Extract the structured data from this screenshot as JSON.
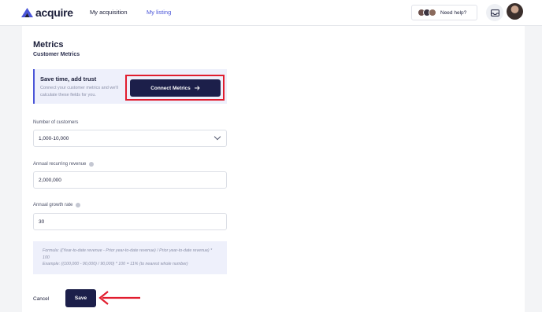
{
  "header": {
    "brand": "acquire",
    "nav": [
      {
        "label": "My acquisition",
        "active": false
      },
      {
        "label": "My listing",
        "active": true
      }
    ],
    "help_label": "Need help?"
  },
  "page": {
    "title": "Metrics",
    "subtitle": "Customer Metrics"
  },
  "promo": {
    "title": "Save time, add trust",
    "description": "Connect your customer metrics and we'll calculate these fields for you.",
    "button_label": "Connect Metrics"
  },
  "fields": {
    "customers": {
      "label": "Number of customers",
      "value": "1,000-10,000"
    },
    "arr": {
      "label": "Annual recurring revenue",
      "value": "2,000,000"
    },
    "growth": {
      "label": "Annual growth rate",
      "value": "30"
    }
  },
  "formula": {
    "text": "Formula: ((Year-to-date revenue - Prior year-to-date revenue) / Prior year-to-date revenue) * 100",
    "example": "Example: ((100,000 - 90,000) / 90,000) * 100 = 11% (to nearest whole number)"
  },
  "actions": {
    "cancel_label": "Cancel",
    "save_label": "Save"
  },
  "colors": {
    "accent": "#4a55d8",
    "primary_button": "#1c1f4a",
    "annotation": "#e11d2e"
  }
}
